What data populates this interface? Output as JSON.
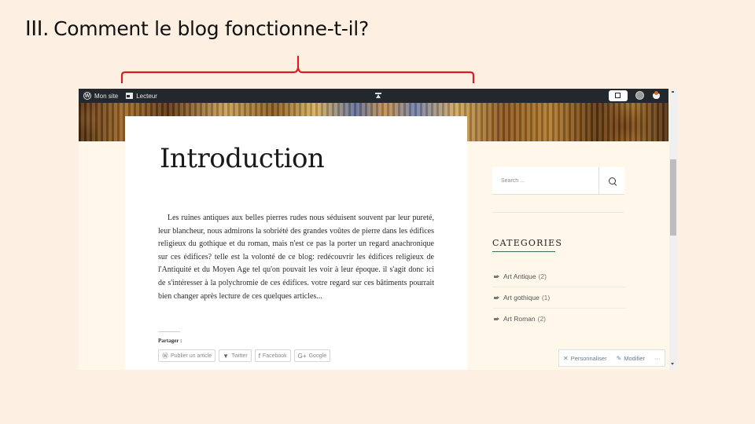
{
  "slide": {
    "numeral": "III.",
    "title": "Comment le blog fonctionne-t-il?",
    "brace_color": "#d42020"
  },
  "adminbar": {
    "site_label": "Mon site",
    "reader_label": "Lecteur",
    "icons": [
      "wordpress-icon",
      "reader-icon",
      "collapse-icon",
      "write-post-icon",
      "avatar-icon",
      "notifications-icon"
    ]
  },
  "post": {
    "title": "Introduction",
    "body": "Les ruines antiques aux belles pierres rudes nous séduisent souvent par leur pureté, leur blancheur, nous admirons la sobriété des grandes voûtes de pierre dans les édifices religieux du gothique et du roman, mais n'est ce pas la porter un regard anachronique sur ces édifices? telle est la volonté de ce blog: redécouvrir les édifices religieux de l'Antiquité et du Moyen Age tel qu'on pouvait les voir à leur époque. il s'agit donc ici de s'intéresser à la polychromie de ces édifices. votre regard sur ces bâtiments pourrait bien changer après lecture de ces quelques articles...",
    "share_label": "Partager :",
    "share_buttons": [
      {
        "label": "Publier un article",
        "icon": "wordpress-icon",
        "glyph": "Ⓦ"
      },
      {
        "label": "Twitter",
        "icon": "twitter-icon",
        "glyph": "🐦"
      },
      {
        "label": "Facebook",
        "icon": "facebook-icon",
        "glyph": "f"
      },
      {
        "label": "Google",
        "icon": "google-icon",
        "glyph": "G+"
      }
    ]
  },
  "sidebar": {
    "search_placeholder": "Search ...",
    "categories_title": "CATEGORIES",
    "categories": [
      {
        "name": "Art Antique",
        "count": "(2)"
      },
      {
        "name": "Art gothique",
        "count": "(1)"
      },
      {
        "name": "Art Roman",
        "count": "(2)"
      }
    ]
  },
  "customize_bar": {
    "customize_label": "Personnaliser",
    "edit_label": "Modifier",
    "more_label": "···"
  }
}
